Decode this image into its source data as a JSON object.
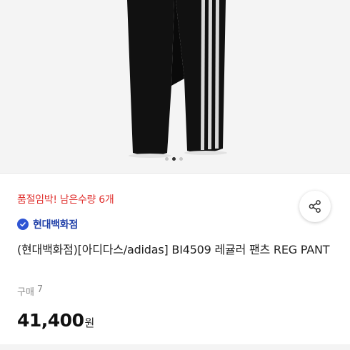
{
  "product": {
    "stock_alert": "품절임박! 남은수량 6개",
    "seller": "현대백화점",
    "title": "(현대백화점)[아디다스/adidas] BI4509 레귤러 팬츠 REG PANT",
    "purchase_label": "구매",
    "purchase_count": "7",
    "price_value": "41,400",
    "price_unit": "원"
  },
  "gallery": {
    "image_count": 3,
    "active_index": 1
  },
  "colors": {
    "alert": "#e0312f",
    "seller": "#1f3fa8",
    "badge": "#2f55d4"
  },
  "icons": {
    "share": "share-icon",
    "verified": "verified-check-icon"
  }
}
